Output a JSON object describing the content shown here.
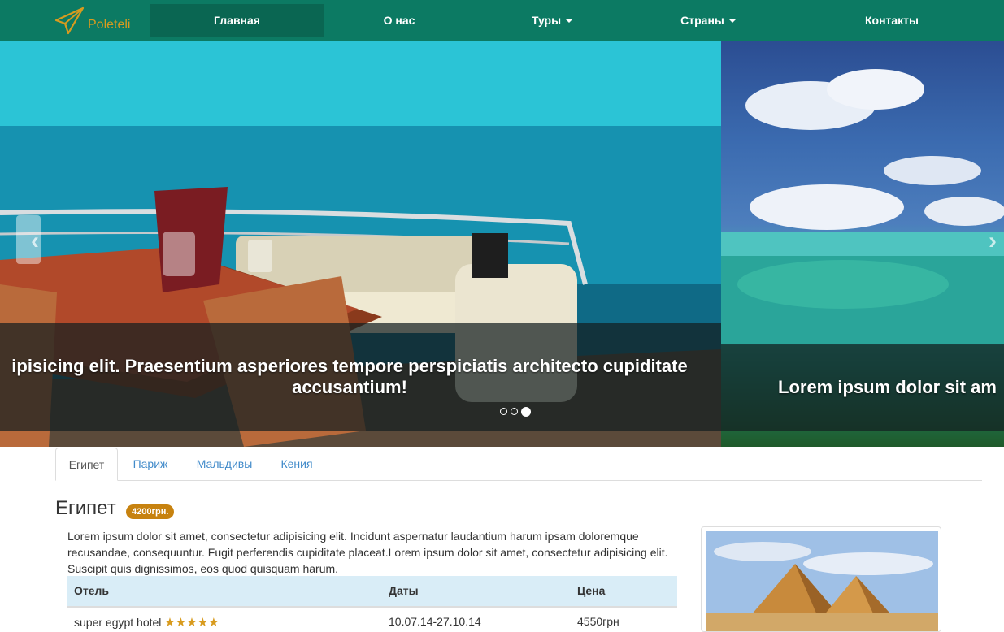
{
  "navbar": {
    "brand": "Poleteli",
    "items": [
      {
        "label": "Главная",
        "active": true
      },
      {
        "label": "О нас"
      },
      {
        "label": "Туры",
        "dropdown": true
      },
      {
        "label": "Страны",
        "dropdown": true
      },
      {
        "label": "Контакты"
      }
    ]
  },
  "carousel": {
    "caption_main": "ipisicing elit. Praesentium asperiores tempore perspiciatis architecto cupiditate accusantium!",
    "caption_next": "Lorem ipsum dolor sit am",
    "indicators_total": 3,
    "active_indicator": 3,
    "prev_icon": "‹",
    "next_icon": "›"
  },
  "tabs": [
    {
      "label": "Египет",
      "active": true
    },
    {
      "label": "Париж"
    },
    {
      "label": "Мальдивы"
    },
    {
      "label": "Кения"
    }
  ],
  "content": {
    "title": "Египет",
    "price": "4200грн.",
    "description": "Lorem ipsum dolor sit amet, consectetur adipisicing elit. Incidunt aspernatur laudantium harum ipsam doloremque recusandae, consequuntur. Fugit perferendis cupiditate placeat.Lorem ipsum dolor sit amet, consectetur adipisicing elit. Suscipit quis dignissimos, eos quod quisquam harum.",
    "table": {
      "headers": [
        "Отель",
        "Даты",
        "Цена"
      ],
      "rows": [
        {
          "hotel": "super egypt hotel",
          "stars": 5,
          "dates": "10.07.14-27.10.14",
          "price": "4550грн"
        }
      ]
    }
  },
  "colors": {
    "navbar": "#0c7a63",
    "navbar_active": "#0a6652",
    "brand": "#d89b1e",
    "badge": "#c7820f",
    "table_head": "#d9edf7",
    "tab_link": "#428bca"
  }
}
